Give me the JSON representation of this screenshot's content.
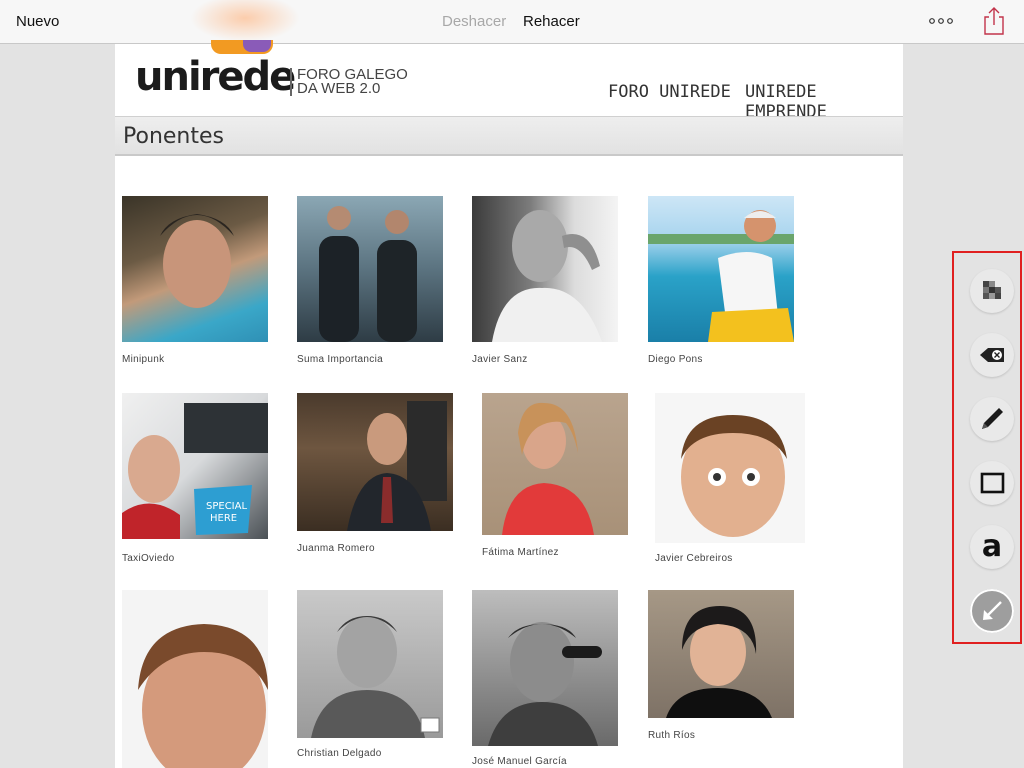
{
  "toolbar": {
    "new_label": "Nuevo",
    "undo_label": "Deshacer",
    "redo_label": "Rehacer",
    "more_icon": "more-dots-icon",
    "share_icon": "share-icon"
  },
  "site": {
    "logo_text": "unirede",
    "logo_sub_line1": "FORO GALEGO",
    "logo_sub_line2": "DA WEB 2.0",
    "nav": [
      "FORO UNIREDE",
      "UNIREDE EMPRENDE"
    ],
    "section_title": "Ponentes"
  },
  "speakers": [
    {
      "name": "Minipunk"
    },
    {
      "name": "Suma Importancia"
    },
    {
      "name": "Javier Sanz"
    },
    {
      "name": "Diego Pons"
    },
    {
      "name": "TaxiOviedo"
    },
    {
      "name": "Juanma Romero"
    },
    {
      "name": "Fátima Martínez"
    },
    {
      "name": "Javier Cebreiros"
    },
    {
      "name": ""
    },
    {
      "name": "Christian Delgado"
    },
    {
      "name": "José Manuel García"
    },
    {
      "name": "Ruth Ríos"
    }
  ],
  "tools": [
    "pixelate-icon",
    "eraser-icon",
    "pen-icon",
    "rectangle-icon",
    "text-icon",
    "arrow-icon"
  ],
  "colors": {
    "highlight_border": "#e02020",
    "logo_orange": "#f29a22",
    "logo_purple": "#8a5bb8"
  }
}
